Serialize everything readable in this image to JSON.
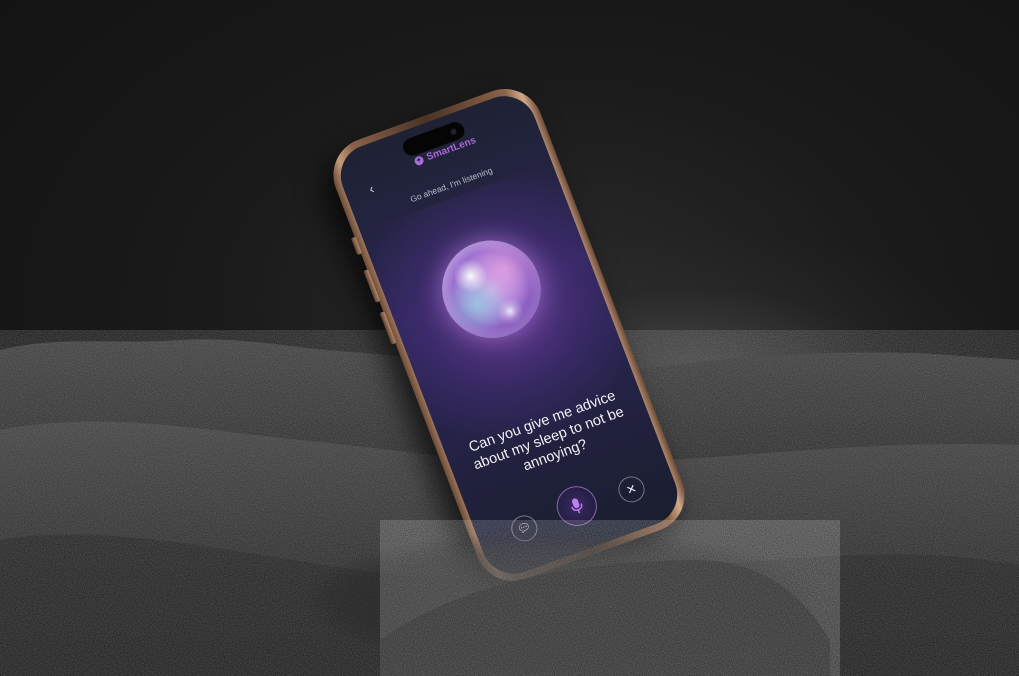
{
  "app": {
    "brand_name": "SmartLens",
    "brand_color": "#a86ad8"
  },
  "header": {
    "back_icon": "chevron-left-icon",
    "status_text": "Go ahead, I'm listening"
  },
  "assistant": {
    "orb_icon": "voice-orb"
  },
  "transcript": {
    "question": "Can you give me advice about my sleep to not be annoying?"
  },
  "controls": {
    "chat_icon": "chat-bubble-icon",
    "mic_icon": "microphone-icon",
    "close_icon": "close-icon",
    "mic_accent": "#c07ff0"
  }
}
